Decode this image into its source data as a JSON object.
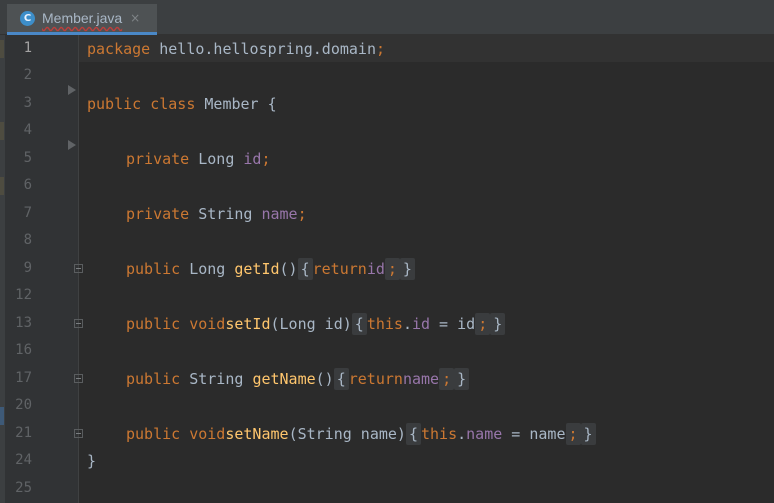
{
  "tab": {
    "icon": "class-c-icon",
    "icon_letter": "C",
    "label": "Member.java",
    "close": "×"
  },
  "gutter": {
    "line_numbers": [
      "1",
      "2",
      "3",
      "4",
      "5",
      "6",
      "7",
      "8",
      "9",
      "12",
      "13",
      "16",
      "17",
      "20",
      "21",
      "24",
      "25"
    ]
  },
  "code": {
    "l1": {
      "kw": "package",
      "rest": " hello.hellospring.domain",
      "semi": ";"
    },
    "l3": {
      "kw": "public class",
      "rest": " Member {"
    },
    "l5": {
      "kw": "private",
      "type": " Long ",
      "field": "id",
      "semi": ";"
    },
    "l7": {
      "kw": "private",
      "type": " String ",
      "field": "name",
      "semi": ";"
    },
    "l9": {
      "kw": "public",
      "type": " Long ",
      "method": "getId",
      "paren": "()",
      "open": "{",
      "ret": "return",
      "field": "id",
      "semi": ";",
      "close": "}"
    },
    "l13": {
      "kw": "public void",
      "method": "setId",
      "params": "(Long id)",
      "open": "{",
      "this": "this",
      "dot": ".",
      "field": "id",
      "assign": " = id",
      "semi": ";",
      "close": "}"
    },
    "l17": {
      "kw": "public",
      "type": " String ",
      "method": "getName",
      "paren": "()",
      "open": "{",
      "ret": "return",
      "field": "name",
      "semi": ";",
      "close": "}"
    },
    "l21": {
      "kw": "public void",
      "method": "setName",
      "params": "(String name)",
      "open": "{",
      "this": "this",
      "dot": ".",
      "field": "name",
      "assign": " = name",
      "semi": ";",
      "close": "}"
    },
    "l24": {
      "text": "}"
    }
  }
}
